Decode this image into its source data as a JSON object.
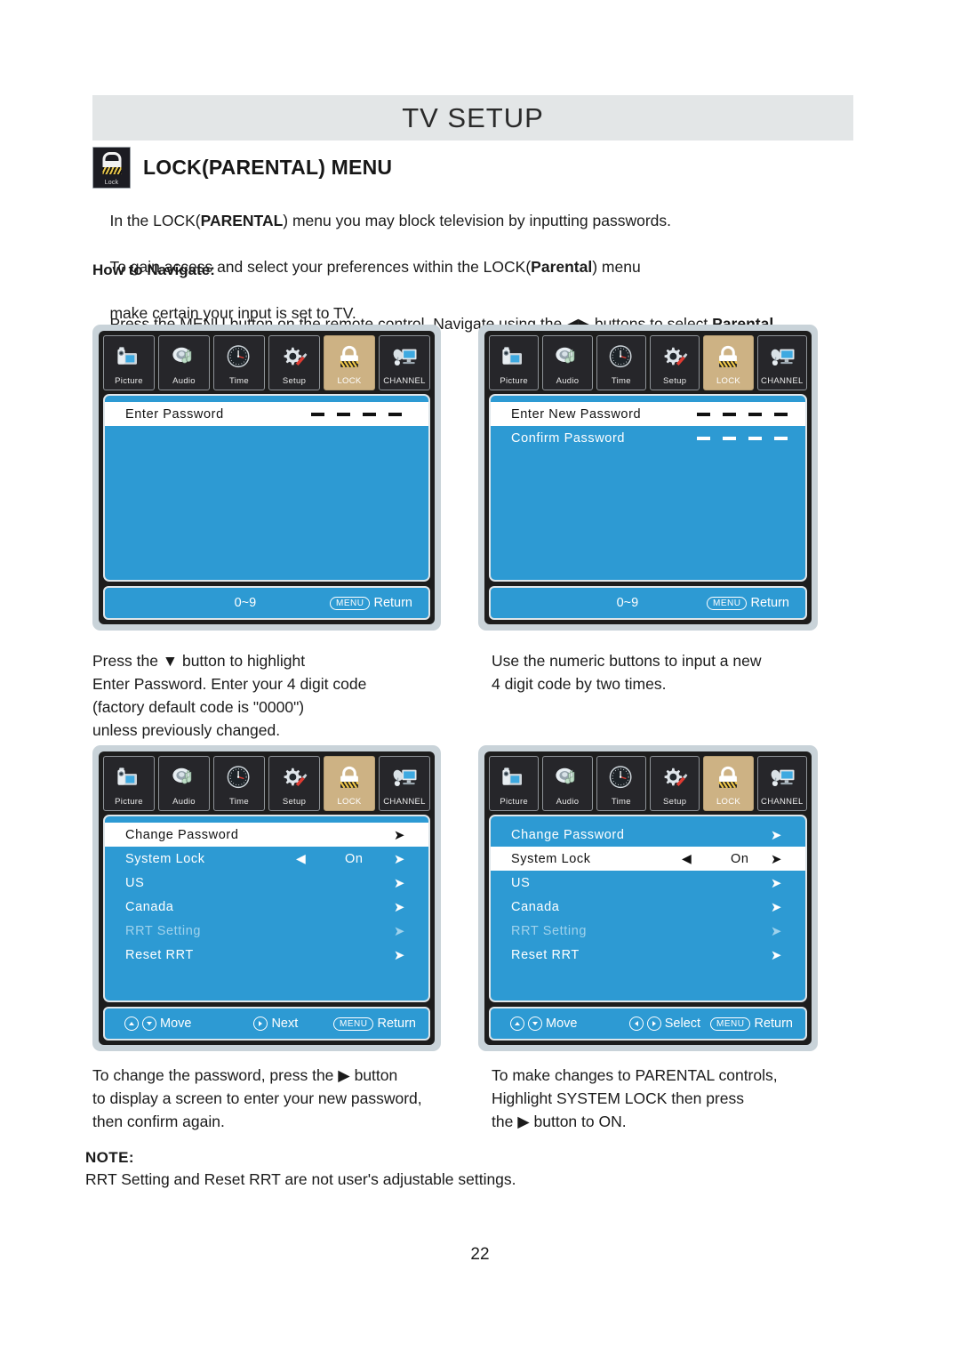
{
  "header": {
    "title": "TV SETUP"
  },
  "section": {
    "icon": "lock-icon",
    "icon_caption": "Lock",
    "title": "LOCK(PARENTAL) MENU",
    "intro_line1_a": "In the LOCK(",
    "intro_line1_b": "PARENTAL",
    "intro_line1_c": ") menu you may block television by inputting passwords.",
    "intro_line2_a": "To gain access and select your preferences within the LOCK(",
    "intro_line2_b": "Parental",
    "intro_line2_c": ") menu",
    "intro_line3": "make certain your input is set to TV.",
    "howto_label": "How to Navigate:",
    "howto_a": "Press the MENU button on the remote control. Navigate using the ",
    "howto_arrows": "◀▶",
    "howto_b": " buttons to select ",
    "howto_c": "Parental",
    "howto_d": "."
  },
  "iconbar": [
    {
      "label": "Picture",
      "icon": "camcorder-icon",
      "active": false
    },
    {
      "label": "Audio",
      "icon": "speaker-music-icon",
      "active": false
    },
    {
      "label": "Time",
      "icon": "clock-icon",
      "active": false
    },
    {
      "label": "Setup",
      "icon": "gear-screwdriver-icon",
      "active": false
    },
    {
      "label": "LOCK",
      "icon": "padlock-icon",
      "active": true
    },
    {
      "label": "CHANNEL",
      "icon": "monitor-dish-icon",
      "active": false
    }
  ],
  "osd1": {
    "name": "enter-password-screen",
    "rows": [
      {
        "label": "Enter Password",
        "selected": true,
        "dashes": 4
      }
    ],
    "footer": {
      "range": "0~9",
      "menu_chip": "MENU",
      "return_label": "Return"
    }
  },
  "osd2": {
    "name": "enter-new-password-screen",
    "rows": [
      {
        "label": "Enter New Password",
        "selected": true,
        "dashes": 4
      },
      {
        "label": "Confirm Password",
        "selected": false,
        "dashes": 4
      }
    ],
    "footer": {
      "range": "0~9",
      "menu_chip": "MENU",
      "return_label": "Return"
    }
  },
  "osd3": {
    "name": "parental-menu-change-password-highlighted",
    "rows": [
      {
        "label": "Change Password",
        "selected": true,
        "dim": false,
        "value": "",
        "left_arrow": false,
        "right_arrow": true
      },
      {
        "label": "System Lock",
        "selected": false,
        "dim": false,
        "value": "On",
        "left_arrow": true,
        "right_arrow": true
      },
      {
        "label": "US",
        "selected": false,
        "dim": false,
        "value": "",
        "left_arrow": false,
        "right_arrow": true
      },
      {
        "label": "Canada",
        "selected": false,
        "dim": false,
        "value": "",
        "left_arrow": false,
        "right_arrow": true
      },
      {
        "label": "RRT Setting",
        "selected": false,
        "dim": true,
        "value": "",
        "left_arrow": false,
        "right_arrow": true
      },
      {
        "label": "Reset RRT",
        "selected": false,
        "dim": false,
        "value": "",
        "left_arrow": false,
        "right_arrow": true
      }
    ],
    "footer": {
      "move_label": "Move",
      "mid_label": "Next",
      "mid_icons": "right",
      "menu_chip": "MENU",
      "return_label": "Return"
    }
  },
  "osd4": {
    "name": "parental-menu-system-lock-highlighted",
    "rows": [
      {
        "label": "Change Password",
        "selected": false,
        "dim": false,
        "value": "",
        "left_arrow": false,
        "right_arrow": true
      },
      {
        "label": "System Lock",
        "selected": true,
        "dim": false,
        "value": "On",
        "left_arrow": true,
        "right_arrow": true
      },
      {
        "label": "US",
        "selected": false,
        "dim": false,
        "value": "",
        "left_arrow": false,
        "right_arrow": true
      },
      {
        "label": "Canada",
        "selected": false,
        "dim": false,
        "value": "",
        "left_arrow": false,
        "right_arrow": true
      },
      {
        "label": "RRT Setting",
        "selected": false,
        "dim": true,
        "value": "",
        "left_arrow": false,
        "right_arrow": true
      },
      {
        "label": "Reset RRT",
        "selected": false,
        "dim": false,
        "value": "",
        "left_arrow": false,
        "right_arrow": true
      }
    ],
    "footer": {
      "move_label": "Move",
      "mid_label": "Select",
      "mid_icons": "leftright",
      "menu_chip": "MENU",
      "return_label": "Return"
    }
  },
  "captions": {
    "c1": "Press the ▼ button to highlight\nEnter Password. Enter your 4 digit code\n(factory default code is \"0000\")\nunless previously changed.",
    "c2": "Use the numeric buttons to input a new\n4 digit code by two times.",
    "c3": "To change the password, press the ▶ button\nto display a screen to enter your new password,\nthen confirm again.",
    "c4": "To make changes to PARENTAL controls,\nHighlight SYSTEM LOCK then press\nthe ▶ button to ON."
  },
  "note": {
    "label": "NOTE:",
    "text": "RRT Setting and Reset RRT are not user's adjustable settings."
  },
  "page_number": "22",
  "colors": {
    "osd_blue": "#2d9ad3",
    "osd_frame": "#c9d3d9",
    "active_tile": "#cdb284",
    "header_band": "#e3e6e7"
  }
}
